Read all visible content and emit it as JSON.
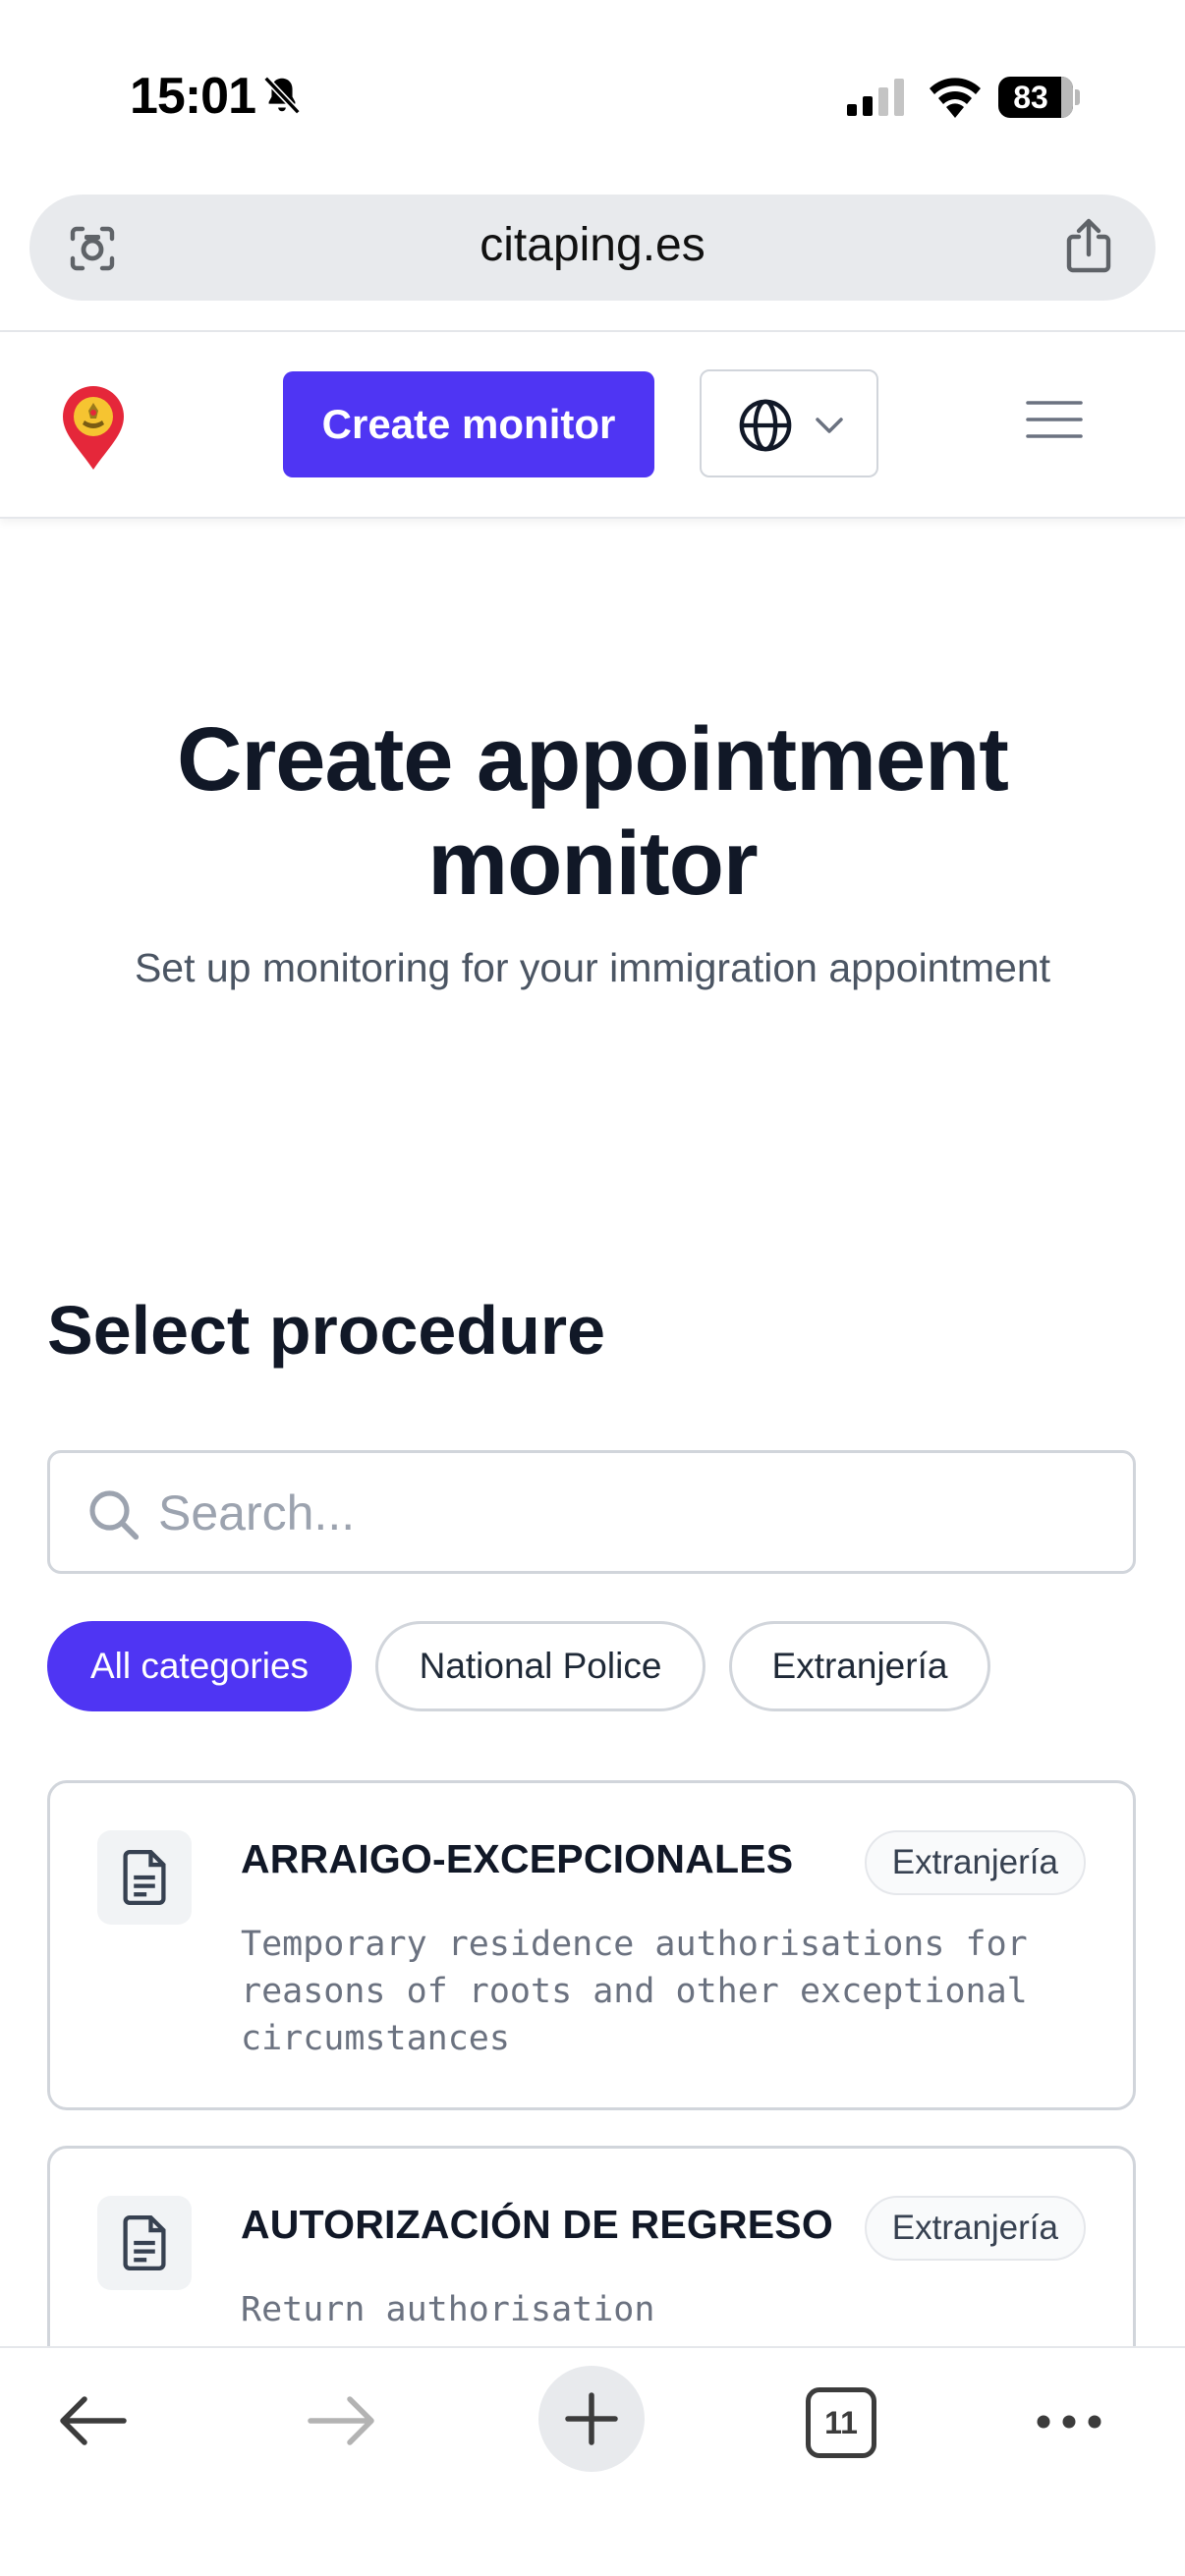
{
  "status_bar": {
    "time": "15:01",
    "battery": "83"
  },
  "browser": {
    "url": "citaping.es",
    "tab_count": "11"
  },
  "header": {
    "create_monitor_label": "Create monitor"
  },
  "hero": {
    "title_line1": "Create appointment",
    "title_line2": "monitor",
    "subtitle": "Set up monitoring for your immigration appointment"
  },
  "procedure": {
    "section_title": "Select procedure",
    "search_placeholder": "Search...",
    "categories": [
      "All categories",
      "National Police",
      "Extranjería"
    ],
    "items": [
      {
        "title": "ARRAIGO-EXCEPCIONALES",
        "category": "Extranjería",
        "description": "Temporary residence authorisations for reasons of roots and other exceptional circumstances"
      },
      {
        "title": "AUTORIZACIÓN DE REGRESO",
        "category": "Extranjería",
        "description": "Return authorisation"
      }
    ]
  },
  "colors": {
    "accent": "#4f35f3",
    "text": "#111827",
    "muted": "#6b7280",
    "border": "#d1d5db"
  },
  "icons": [
    "bell-slash-icon",
    "signal-icon",
    "wifi-icon",
    "camera-icon",
    "share-icon",
    "logo-icon",
    "globe-icon",
    "chevron-down-icon",
    "hamburger-icon",
    "search-icon",
    "document-icon",
    "back-arrow-icon",
    "forward-arrow-icon",
    "plus-icon",
    "more-icon"
  ]
}
